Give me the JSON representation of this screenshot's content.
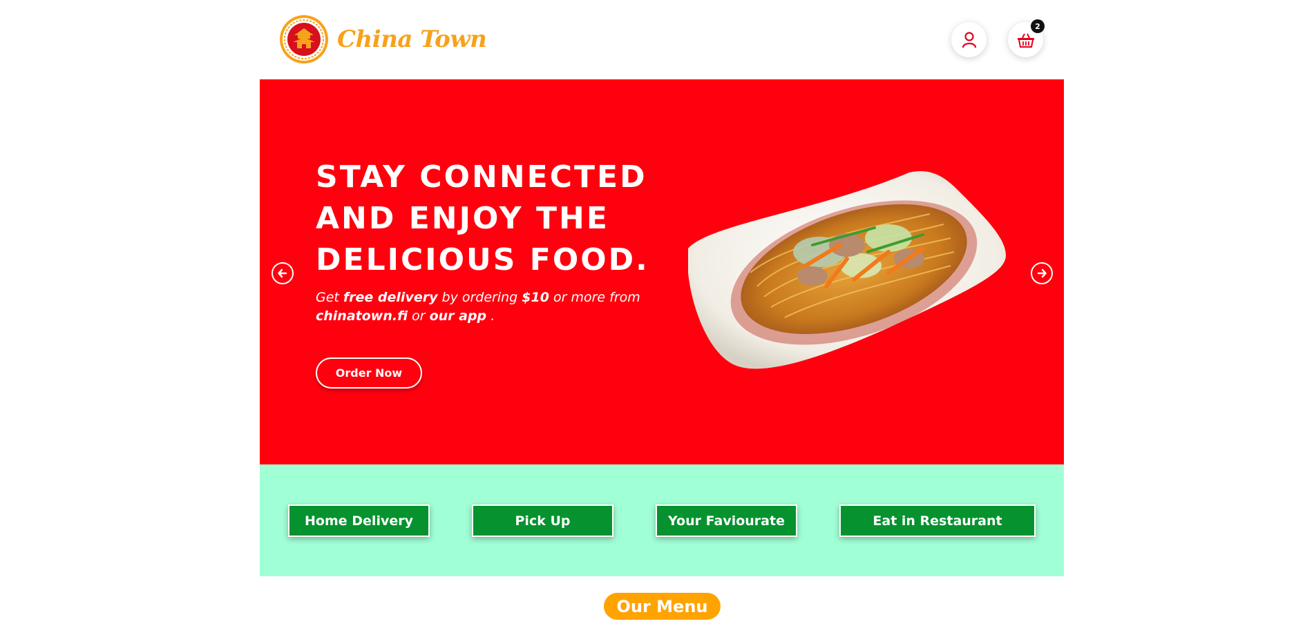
{
  "brand": {
    "name": "China Town",
    "logo_icon": "pagoda-logo-icon",
    "accent": "#f7a21b"
  },
  "header": {
    "user_icon": "user-icon",
    "cart_icon": "basket-icon",
    "cart_count": "2"
  },
  "hero": {
    "title_line1": "STAY CONNECTED",
    "title_line2": "AND ENJOY THE",
    "title_line3": "DELICIOUS FOOD.",
    "sub_1": "Get ",
    "sub_2": "free delivery",
    "sub_3": " by ordering ",
    "sub_4": "$10",
    "sub_5": " or more from ",
    "sub_6": "chinatown.fi",
    "sub_7": " or ",
    "sub_8": "our app",
    "sub_9": " .",
    "order_button": "Order Now",
    "prev_icon": "arrow-left-circle-icon",
    "next_icon": "arrow-right-circle-icon",
    "background": "#ff000e"
  },
  "services": {
    "background": "#a1ffd6",
    "button_color": "#05922f",
    "items": [
      "Home Delivery",
      "Pick Up",
      "Your Faviourate",
      "Eat in Restaurant"
    ]
  },
  "menu": {
    "label": "Our Menu",
    "color": "#ffa300"
  }
}
